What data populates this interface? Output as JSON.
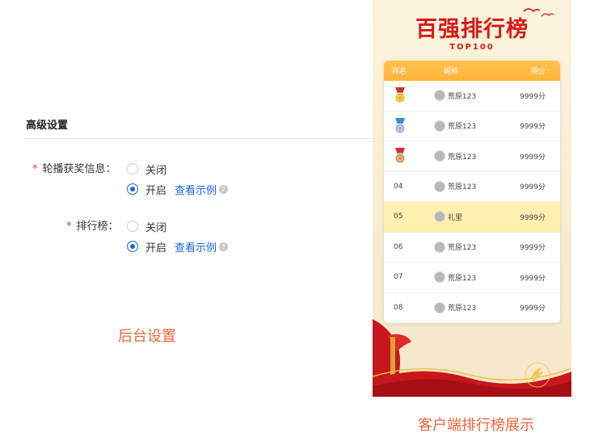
{
  "settings": {
    "section_title": "高级设置",
    "carousel": {
      "label": "轮播获奖信息：",
      "options": [
        "关闭",
        "开启"
      ],
      "selected": "开启",
      "example_link": "查看示例"
    },
    "leaderboard": {
      "label": "排行榜：",
      "options": [
        "关闭",
        "开启"
      ],
      "selected": "开启",
      "example_link": "查看示例"
    },
    "required_mark": "*",
    "help_glyph": "?",
    "caption": "后台设置"
  },
  "preview": {
    "title": "百强排行榜",
    "subtitle": "TOP100",
    "columns": [
      "排名",
      "昵称",
      "得分"
    ],
    "rows": [
      {
        "rank": "",
        "medal": "gold",
        "name": "荒原123",
        "score": "9999分",
        "highlight": false
      },
      {
        "rank": "",
        "medal": "silver",
        "name": "荒原123",
        "score": "9999分",
        "highlight": false
      },
      {
        "rank": "",
        "medal": "bronze",
        "name": "荒原123",
        "score": "9999分",
        "highlight": false
      },
      {
        "rank": "04",
        "medal": "",
        "name": "荒原123",
        "score": "9999分",
        "highlight": false
      },
      {
        "rank": "05",
        "medal": "",
        "name": "礼里",
        "score": "9999分",
        "highlight": true
      },
      {
        "rank": "06",
        "medal": "",
        "name": "荒原123",
        "score": "9999分",
        "highlight": false
      },
      {
        "rank": "07",
        "medal": "",
        "name": "荒原123",
        "score": "9999分",
        "highlight": false
      },
      {
        "rank": "08",
        "medal": "",
        "name": "荒原123",
        "score": "9999分",
        "highlight": false
      }
    ],
    "caption": "客户端排行榜展示"
  },
  "colors": {
    "accent": "#1a66d6",
    "required": "#e4393c",
    "caption": "#e8663b",
    "title_red": "#d41a1a",
    "header_orange": "#ffb43a",
    "highlight_row": "#fff0b0"
  }
}
